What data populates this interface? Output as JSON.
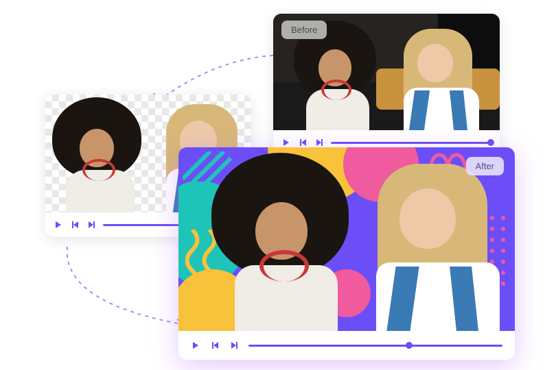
{
  "badges": {
    "before": "Before",
    "after": "After"
  },
  "colors": {
    "accent": "#6b4ef6",
    "pink": "#f05a9e",
    "yellow": "#f8c23a",
    "teal": "#1fc4b8"
  },
  "icons": {
    "play": "play",
    "prev": "skip-previous",
    "next": "skip-next"
  }
}
